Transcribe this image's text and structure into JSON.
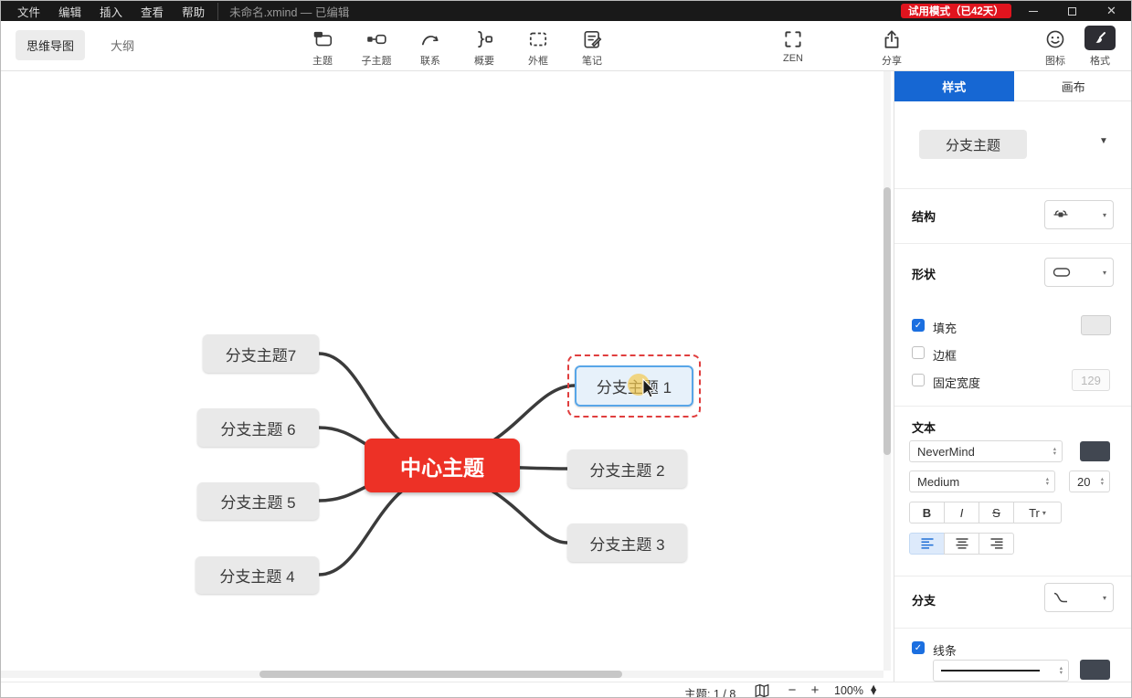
{
  "titlebar": {
    "menus": [
      "文件",
      "编辑",
      "插入",
      "查看",
      "帮助"
    ],
    "document_title": "未命名.xmind — 已编辑",
    "trial_badge": "试用模式（已42天）"
  },
  "toolbar": {
    "tab_mindmap": "思维导图",
    "tab_outline": "大纲",
    "topic": "主题",
    "subtopic": "子主题",
    "relationship": "联系",
    "summary": "概要",
    "boundary": "外框",
    "notes": "笔记",
    "zen": "ZEN",
    "share": "分享",
    "icons_label": "图标",
    "format_label": "格式"
  },
  "canvas": {
    "central_topic": "中心主题",
    "branches": [
      {
        "label": "分支主题 1",
        "selected": true
      },
      {
        "label": "分支主题 2",
        "selected": false
      },
      {
        "label": "分支主题 3",
        "selected": false
      },
      {
        "label": "分支主题 4",
        "selected": false
      },
      {
        "label": "分支主题 5",
        "selected": false
      },
      {
        "label": "分支主题 6",
        "selected": false
      },
      {
        "label": "分支主题7",
        "selected": false
      }
    ]
  },
  "panel": {
    "tab_style": "样式",
    "tab_canvas": "画布",
    "topic_type": "分支主题",
    "structure_label": "结构",
    "shape_label": "形状",
    "fill_label": "填充",
    "border_label": "边框",
    "fixed_width_label": "固定宽度",
    "fixed_width_value": "129",
    "text_label": "文本",
    "font_family": "NeverMind",
    "font_weight": "Medium",
    "font_size": "20",
    "bold_label": "B",
    "italic_label": "I",
    "strike_label": "S",
    "transform_label": "Tr",
    "branch_label": "分支",
    "line_label": "线条"
  },
  "statusbar": {
    "topic_count": "主题: 1 / 8",
    "zoom_level": "100%"
  },
  "icons": {
    "close": "✕",
    "check": "✓",
    "dropdown_arrow": "▼",
    "chevron_down": "▾",
    "stepper_up": "▴",
    "stepper_down": "▾",
    "minus": "−",
    "plus": "+"
  },
  "colors": {
    "accent_blue": "#1667d3",
    "central_topic_red": "#ed3126",
    "trial_badge_red": "#e0141e",
    "selected_fill_blue": "#e7f1fa",
    "selected_border_blue": "#58a6e8",
    "selection_dashed_red": "#e03e3e",
    "branch_fill_gray": "#e9e9e9",
    "edge_line": "#3b3b3b"
  }
}
